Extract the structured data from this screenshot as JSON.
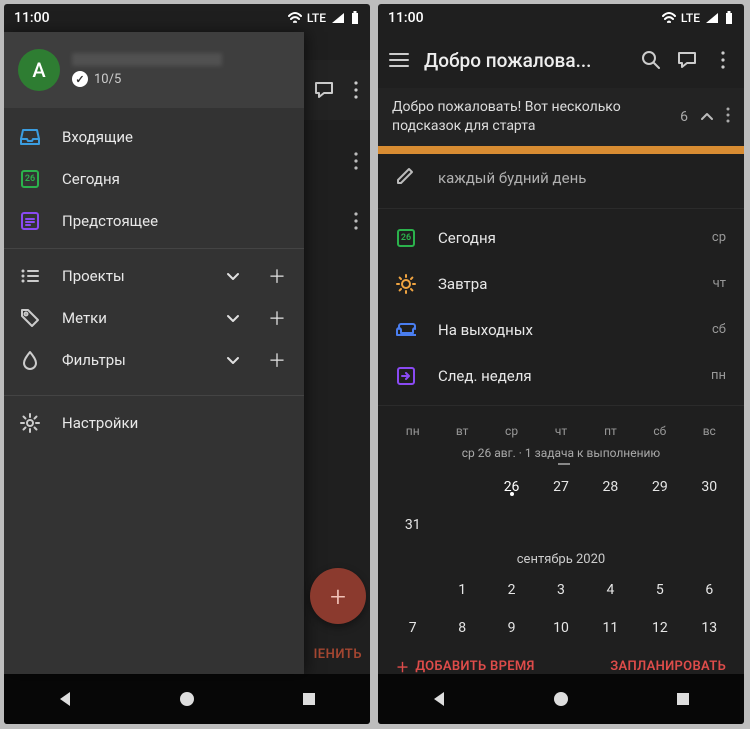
{
  "status": {
    "time": "11:00",
    "network": "LTE"
  },
  "left": {
    "profile": {
      "initial": "A",
      "score": "10/5"
    },
    "peek_actions": {
      "comment": "",
      "more1": "",
      "more2": ""
    },
    "nav": {
      "inbox": "Входящие",
      "today": "Сегодня",
      "today_num": "26",
      "upcoming": "Предстоящее",
      "projects": "Проекты",
      "labels": "Метки",
      "filters": "Фильтры",
      "settings": "Настройки"
    },
    "fab": "+",
    "cancel_peek": "ІЕНИТЬ"
  },
  "right": {
    "appbar": {
      "title": "Добро пожалова..."
    },
    "banner": {
      "text": "Добро пожаловать! Вот несколько подсказок для старта",
      "count": "6"
    },
    "recurrence": "каждый будний день",
    "suggestions": {
      "today": {
        "label": "Сегодня",
        "tail": "ср",
        "num": "26"
      },
      "tomorrow": {
        "label": "Завтра",
        "tail": "чт"
      },
      "weekend": {
        "label": "На выходных",
        "tail": "сб"
      },
      "nextweek": {
        "label": "След. неделя",
        "tail": "пн"
      }
    },
    "calendar": {
      "dow": [
        "пн",
        "вт",
        "ср",
        "чт",
        "пт",
        "сб",
        "вс"
      ],
      "sub": "ср 26 авг. · 1 задача к выполнению",
      "aug_row": [
        "",
        "",
        "26",
        "27",
        "28",
        "29",
        "30"
      ],
      "aug_row2": [
        "31",
        "",
        "",
        "",
        "",
        "",
        ""
      ],
      "month": "сентябрь 2020",
      "sep_row1": [
        "",
        "1",
        "2",
        "3",
        "4",
        "5",
        "6"
      ],
      "sep_row2": [
        "7",
        "8",
        "9",
        "10",
        "11",
        "12",
        "13"
      ]
    },
    "actions": {
      "add_time": "ДОБАВИТЬ ВРЕМЯ",
      "schedule": "ЗАПЛАНИРОВАТЬ"
    }
  }
}
